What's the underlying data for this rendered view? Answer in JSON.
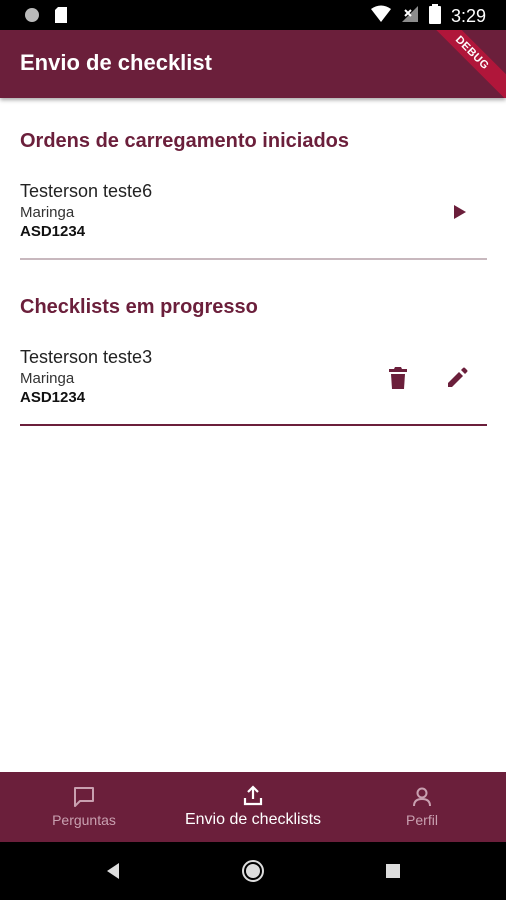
{
  "status_bar": {
    "time": "3:29"
  },
  "app_bar": {
    "title": "Envio de checklist",
    "debug_label": "DEBUG"
  },
  "sections": {
    "started_orders": {
      "title": "Ordens de carregamento iniciados",
      "items": [
        {
          "name": "Testerson teste6",
          "city": "Maringa",
          "code": "ASD1234"
        }
      ]
    },
    "in_progress": {
      "title": "Checklists em progresso",
      "items": [
        {
          "name": "Testerson teste3",
          "city": "Maringa",
          "code": "ASD1234"
        }
      ]
    }
  },
  "bottom_nav": {
    "items": [
      {
        "label": "Perguntas",
        "icon": "chat-bubble-icon",
        "active": false
      },
      {
        "label": "Envio de checklists",
        "icon": "upload-icon",
        "active": true
      },
      {
        "label": "Perfil",
        "icon": "person-icon",
        "active": false
      }
    ]
  },
  "colors": {
    "primary": "#6b1f3b",
    "inactive_nav": "#c9a0b0"
  }
}
